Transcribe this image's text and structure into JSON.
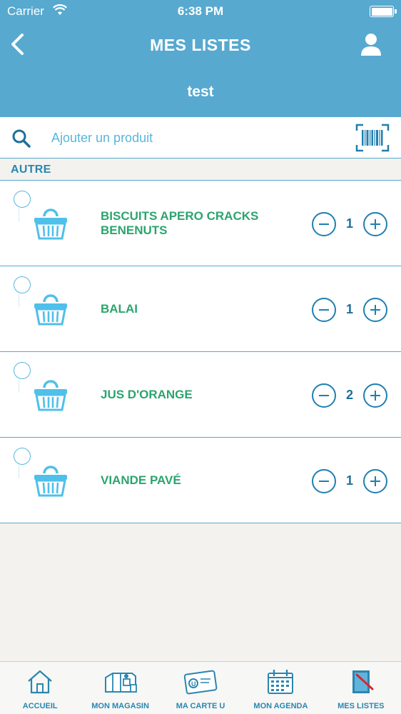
{
  "status_bar": {
    "carrier": "Carrier",
    "time": "6:38 PM"
  },
  "header": {
    "title": "MES LISTES",
    "list_name": "test"
  },
  "search": {
    "placeholder": "Ajouter un produit"
  },
  "section": {
    "title": "AUTRE"
  },
  "items": [
    {
      "name": "BISCUITS APERO CRACKS BENENUTS",
      "quantity": "1",
      "checked": false
    },
    {
      "name": "BALAI",
      "quantity": "1",
      "checked": false
    },
    {
      "name": "JUS D'ORANGE",
      "quantity": "2",
      "checked": false
    },
    {
      "name": "VIANDE PAVÉ",
      "quantity": "1",
      "checked": false
    }
  ],
  "tabs": [
    {
      "label": "ACCUEIL",
      "icon": "home-icon"
    },
    {
      "label": "MON MAGASIN",
      "icon": "store-icon"
    },
    {
      "label": "MA CARTE U",
      "icon": "loyalty-card-icon"
    },
    {
      "label": "MON AGENDA",
      "icon": "calendar-icon"
    },
    {
      "label": "MES LISTES",
      "icon": "shopping-list-icon",
      "active": true
    }
  ],
  "colors": {
    "header_bg": "#57a9cf",
    "item_name": "#2ba46e",
    "accent": "#2a86b0",
    "background": "#f3f2ee"
  }
}
